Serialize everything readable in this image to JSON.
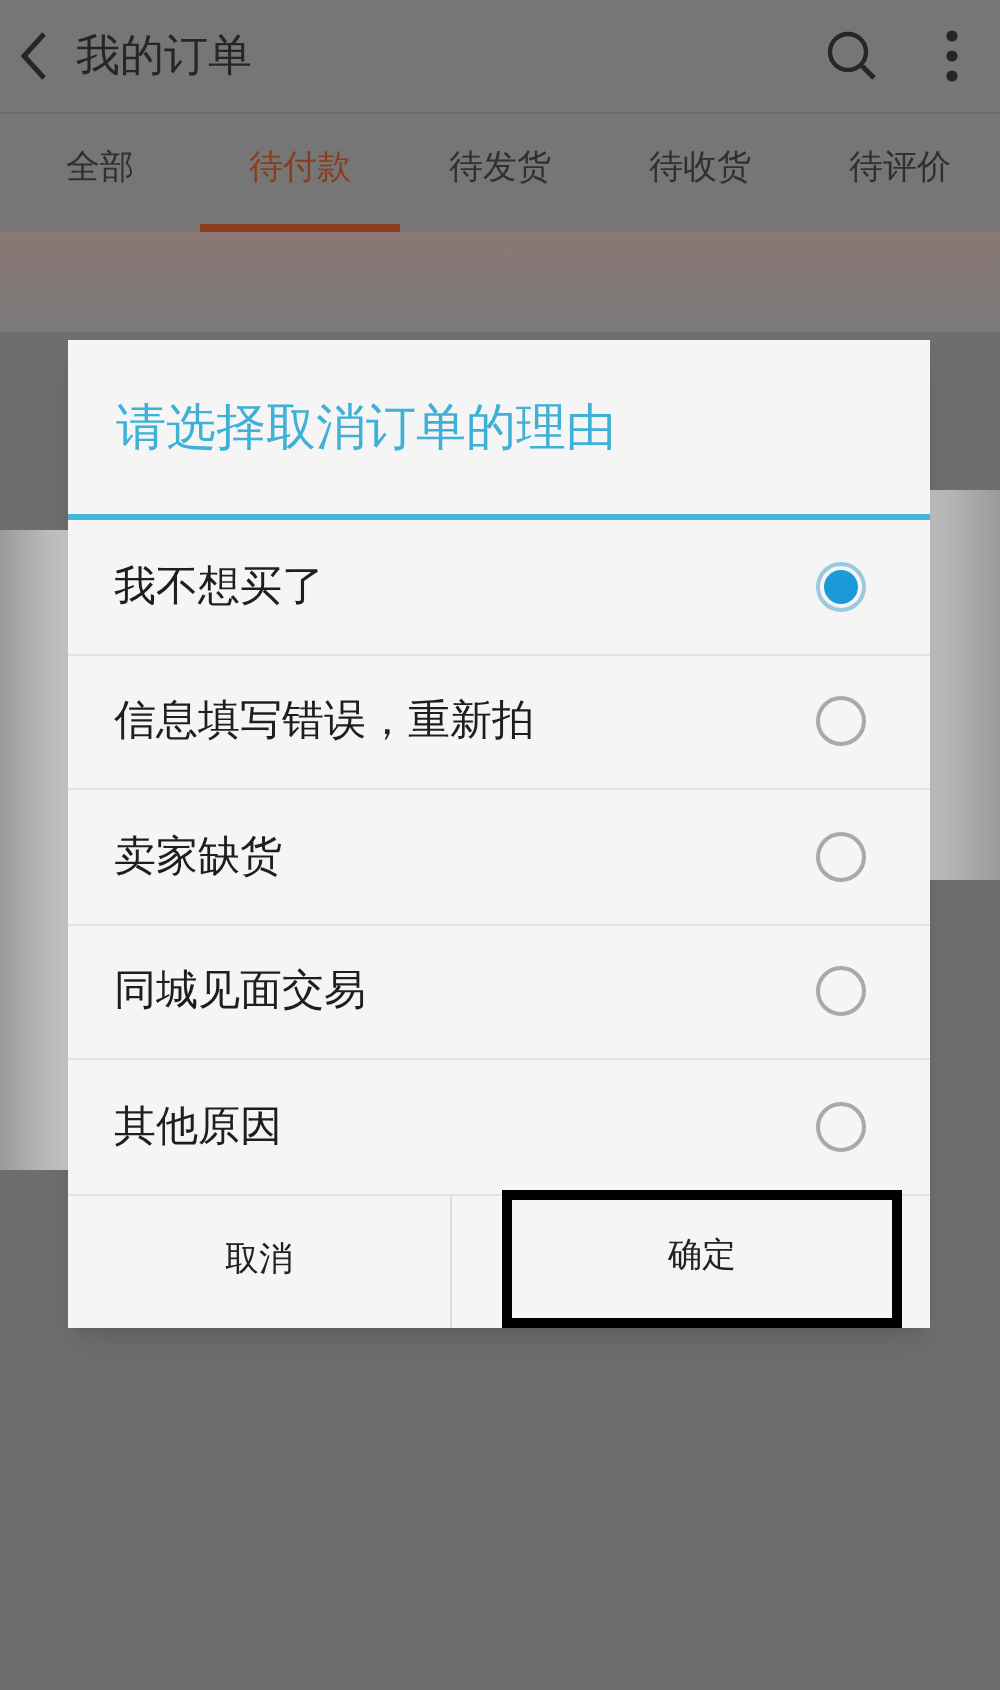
{
  "header": {
    "title": "我的订单"
  },
  "tabs": [
    {
      "label": "全部",
      "selected": false
    },
    {
      "label": "待付款",
      "selected": true
    },
    {
      "label": "待发货",
      "selected": false
    },
    {
      "label": "待收货",
      "selected": false
    },
    {
      "label": "待评价",
      "selected": false
    }
  ],
  "dialog": {
    "title": "请选择取消订单的理由",
    "options": [
      {
        "label": "我不想买了",
        "selected": true
      },
      {
        "label": "信息填写错误，重新拍",
        "selected": false
      },
      {
        "label": "卖家缺货",
        "selected": false
      },
      {
        "label": "同城见面交易",
        "selected": false
      },
      {
        "label": "其他原因",
        "selected": false
      }
    ],
    "buttons": [
      {
        "label": "取消",
        "highlighted": false
      },
      {
        "label": "确定",
        "highlighted": true
      }
    ]
  }
}
